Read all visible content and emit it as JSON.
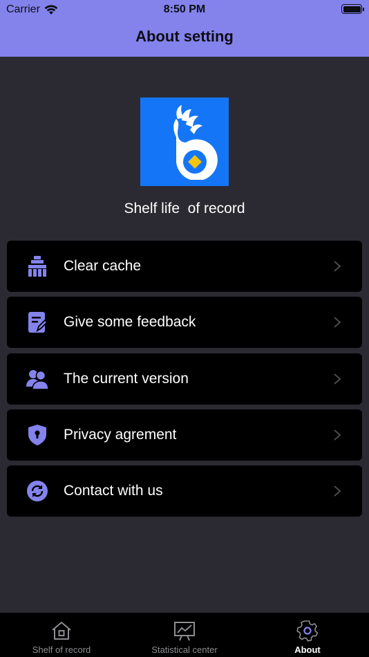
{
  "status_bar": {
    "carrier": "Carrier",
    "time": "8:50 PM",
    "icons": [
      "wifi-icon",
      "battery-icon"
    ]
  },
  "nav": {
    "title": "About setting"
  },
  "app": {
    "name": "Shelf life  of record",
    "logo_icon": "peacock-b-logo",
    "logo_color": "#1476f6"
  },
  "menu": {
    "items": [
      {
        "label": "Clear cache",
        "icon": "broom-icon"
      },
      {
        "label": "Give some feedback",
        "icon": "feedback-edit-icon"
      },
      {
        "label": "The current version",
        "icon": "users-icon"
      },
      {
        "label": "Privacy agrement",
        "icon": "shield-lock-icon"
      },
      {
        "label": "Contact with us",
        "icon": "refresh-circle-icon"
      }
    ]
  },
  "tabbar": {
    "tabs": [
      {
        "label": "Shelf of record",
        "icon": "home-icon",
        "active": false
      },
      {
        "label": "Statistical center",
        "icon": "chart-board-icon",
        "active": false
      },
      {
        "label": "About",
        "icon": "gear-icon",
        "active": true
      }
    ]
  },
  "colors": {
    "header": "#8483ec",
    "background": "#2b2a32",
    "accent_icon": "#8483ec",
    "card": "#000000"
  }
}
